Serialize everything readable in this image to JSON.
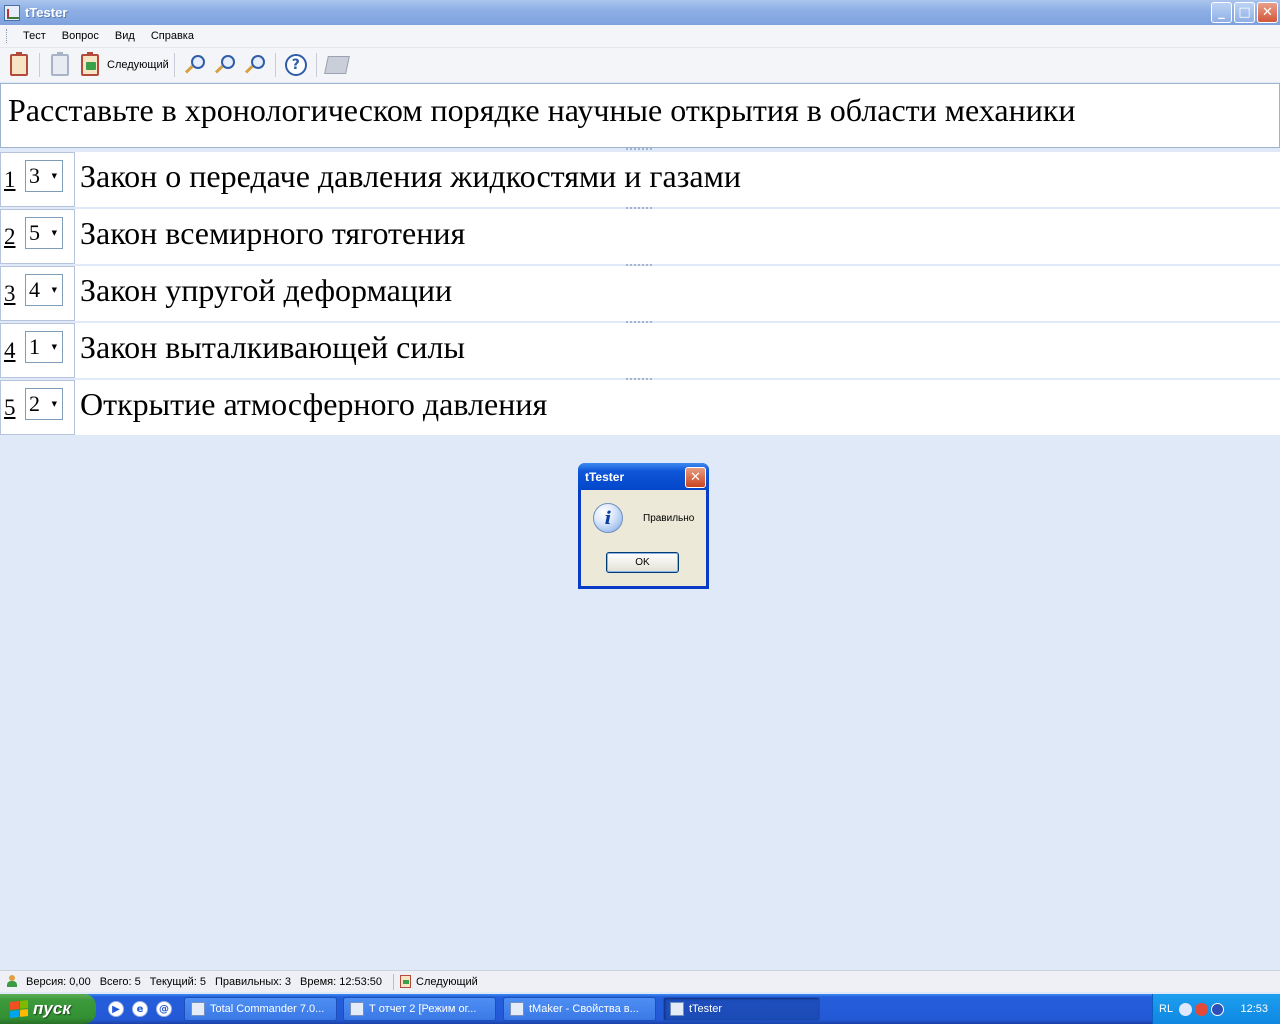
{
  "window": {
    "title": "tTester",
    "buttons": {
      "minimize": "_",
      "maximize": "□",
      "close": "✕"
    }
  },
  "menu": [
    "Тест",
    "Вопрос",
    "Вид",
    "Справка"
  ],
  "toolbar": {
    "next_label": "Следующий",
    "help_glyph": "?"
  },
  "question": {
    "text": "Расставьте в хронологическом порядке научные открытия в области механики"
  },
  "items": [
    {
      "num": "1",
      "value": "3",
      "text": "Закон о передаче давления жидкостями и газами"
    },
    {
      "num": "2",
      "value": "5",
      "text": "Закон всемирного тяготения"
    },
    {
      "num": "3",
      "value": "4",
      "text": "Закон упругой деформации"
    },
    {
      "num": "4",
      "value": "1",
      "text": "Закон выталкивающей силы"
    },
    {
      "num": "5",
      "value": "2",
      "text": "Открытие атмосферного давления"
    }
  ],
  "dialog": {
    "title": "tTester",
    "message": "Правильно",
    "ok": "OK",
    "close": "✕",
    "info_glyph": "i"
  },
  "status": {
    "version": "Версия: 0,00",
    "total": "Всего: 5",
    "current": "Текущий: 5",
    "correct": "Правильных: 3",
    "time": "Время: 12:53:50",
    "next": "Следующий"
  },
  "taskbar": {
    "start": "пуск",
    "tasks": [
      "Total Commander 7.0...",
      "Т отчет 2 [Режим ог...",
      "tMaker - Свойства в...",
      "tTester"
    ],
    "lang": "RL",
    "clock": "12:53"
  }
}
